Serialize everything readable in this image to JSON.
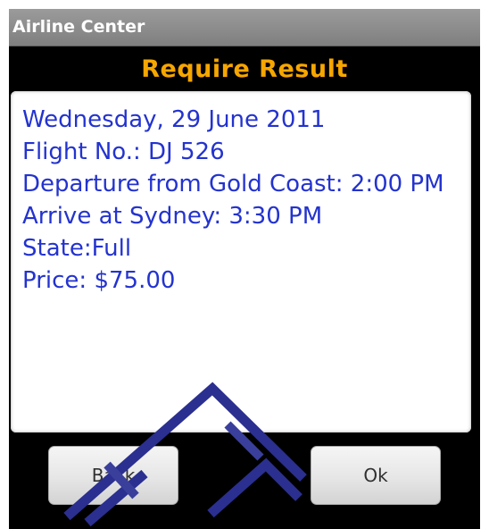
{
  "app": {
    "title": "Airline Center"
  },
  "page": {
    "heading": "Require Result",
    "heading_color": "#f7a600",
    "text_color": "#2333cf"
  },
  "result": {
    "date": "Wednesday, 29 June 2011",
    "flight": "Flight No.: DJ 526",
    "departure": "Departure from Gold Coast: 2:00 PM",
    "arrival": "Arrive at Sydney: 3:30 PM",
    "state": "State:Full",
    "price": "Price: $75.00"
  },
  "buttons": {
    "back_label": "Back",
    "ok_label": "Ok"
  }
}
